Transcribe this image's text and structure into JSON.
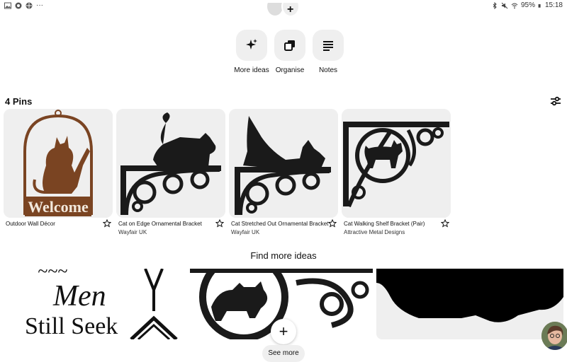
{
  "status_bar": {
    "battery": "95%",
    "time": "15:18",
    "menu_dots": "···"
  },
  "actions": [
    {
      "label": "More ideas",
      "icon": "sparkle-icon"
    },
    {
      "label": "Organise",
      "icon": "organise-icon"
    },
    {
      "label": "Notes",
      "icon": "notes-icon"
    }
  ],
  "pins_section": {
    "title": "4 Pins"
  },
  "pins": [
    {
      "title": "Outdoor Wall Décor",
      "source": "",
      "image_text": "Welcome"
    },
    {
      "title": "Cat on Edge Ornamental Bracket",
      "source": "Wayfair UK"
    },
    {
      "title": "Cat Stretched Out Ornamental Bracket",
      "source": "Wayfair UK"
    },
    {
      "title": "Cat Walking Shelf Bracket (Pair)",
      "source": "Attractive Metal Designs"
    }
  ],
  "find_more": {
    "title": "Find more ideas",
    "idea1_text_line1": "Men",
    "idea1_text_line2": "Still Seek",
    "see_more": "See more"
  },
  "fab_label": "+",
  "colors": {
    "button_bg": "#efefef",
    "silhouette": "#1a1a1a",
    "rust": "#7a4422"
  }
}
